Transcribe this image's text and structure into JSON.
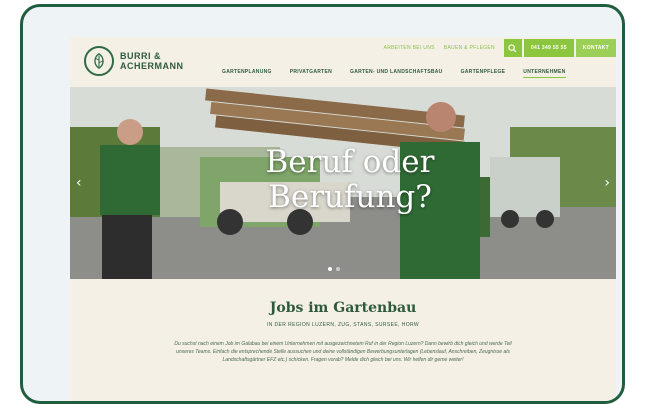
{
  "logo": {
    "line1": "BURRI &",
    "line2": "ACHERMANN"
  },
  "utility": {
    "links": [
      "ARBEITEN BEI UNS",
      "BAUEN & PFLEGEN"
    ],
    "phone": "041 349 55 55",
    "contact": "KONTAKT"
  },
  "nav": {
    "items": [
      "GARTENPLANUNG",
      "PRIVATGARTEN",
      "GARTEN- UND LANDSCHAFTSBAU",
      "GARTENPFLEGE",
      "UNTERNEHMEN"
    ]
  },
  "hero": {
    "title_line1": "Beruf oder",
    "title_line2": "Berufung?",
    "prev_arrow": "‹",
    "next_arrow": "›"
  },
  "jobs": {
    "title": "Jobs im Gartenbau",
    "subtitle": "IN DER REGION LUZERN, ZUG, STANS, SURSEE, HORW",
    "text": "Du suchst nach einem Job im Galabau bei einem Unternehmen mit ausgezeichnetem Ruf in der Region Luzern? Dann bewirb dich gleich und werde Teil unseres Teams. Einfach die entsprechende Stelle aussuchen und deine vollständigen Bewerbungsunterlagen (Lebenslauf, Anschreiben, Zeugnisse als Landschaftsgärtner EFZ etc.) schicken. Fragen vorab? Melde dich gleich bei uns. Wir helfen dir gerne weiter!"
  },
  "colors": {
    "brand_green": "#2e5a3c",
    "accent_green": "#8cc63f",
    "frame": "#1f5f3f",
    "background": "#f4f0e6"
  },
  "icons": {
    "logo": "leaf-circle-icon",
    "search": "search-icon"
  }
}
